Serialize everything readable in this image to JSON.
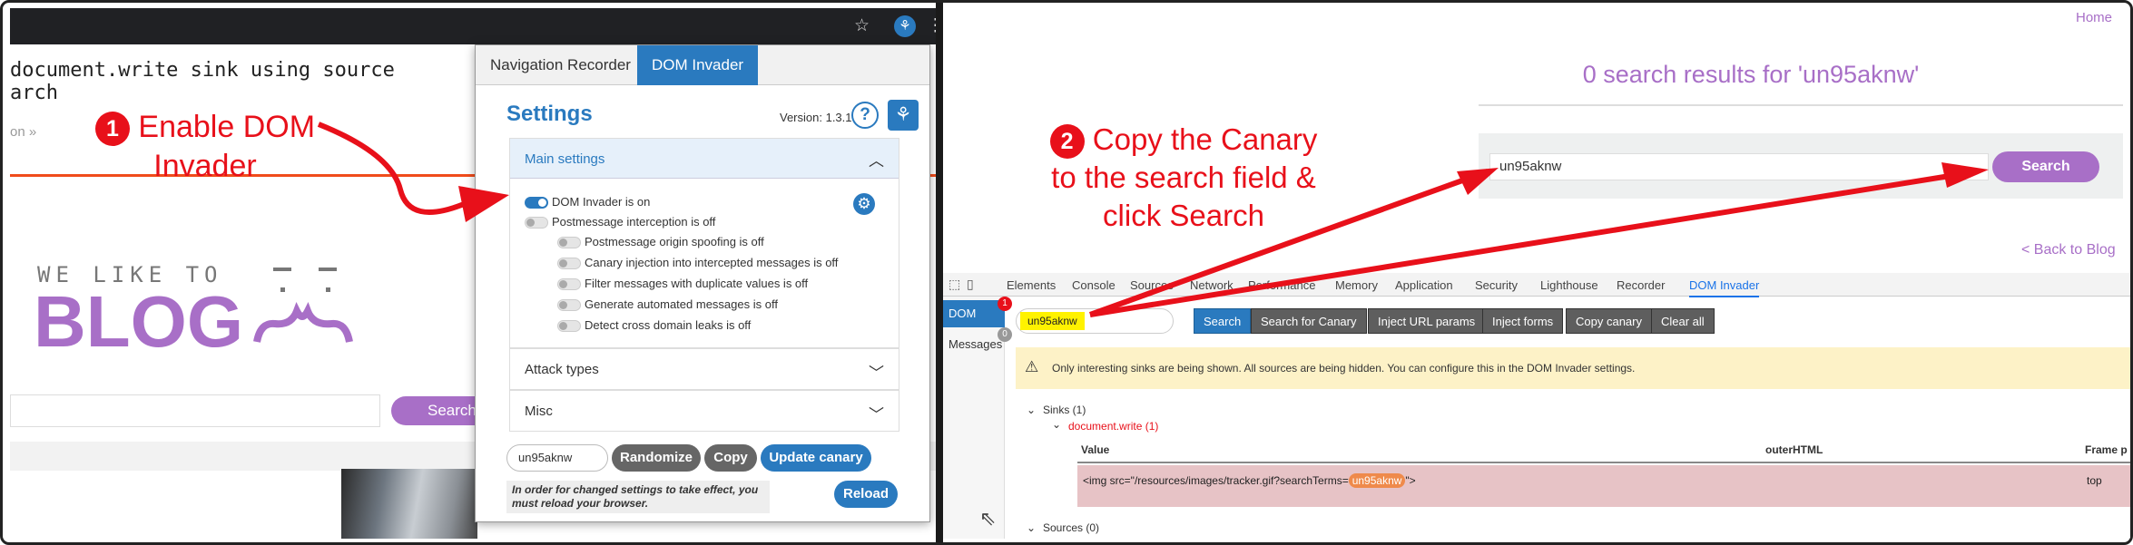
{
  "left": {
    "page_title_line1": "document.write sink using source",
    "page_title_line2": "arch",
    "breadcrumb": "on »",
    "blog_tag": "WE LIKE TO",
    "blog_name": "BLOG",
    "search_button": "Search"
  },
  "popup": {
    "tabs": [
      "Navigation Recorder",
      "DOM Invader"
    ],
    "settings_title": "Settings",
    "version": "Version: 1.3.1",
    "help_icon": "question-circle-icon",
    "main_settings_label": "Main settings",
    "options": [
      {
        "label": "DOM Invader is on",
        "on": true
      },
      {
        "label": "Postmessage interception is off",
        "on": false
      },
      {
        "label": "Postmessage origin spoofing is off",
        "on": false
      },
      {
        "label": "Canary injection into intercepted messages is off",
        "on": false
      },
      {
        "label": "Filter messages with duplicate values is off",
        "on": false
      },
      {
        "label": "Generate automated messages is off",
        "on": false
      },
      {
        "label": "Detect cross domain leaks is off",
        "on": false
      }
    ],
    "attack_types_label": "Attack types",
    "misc_label": "Misc",
    "canary_value": "un95aknw",
    "randomize_label": "Randomize",
    "copy_label": "Copy",
    "update_canary_label": "Update canary",
    "reload_notice": "In order for changed settings to take effect, you must reload your browser.",
    "reload_label": "Reload"
  },
  "right": {
    "home_link": "Home",
    "results_text": "0 search results for 'un95aknw'",
    "search_value": "un95aknw",
    "search_button": "Search",
    "back_link": "< Back to Blog",
    "devtools_tabs": [
      "Elements",
      "Console",
      "Sources",
      "Network",
      "Performance",
      "Memory",
      "Application",
      "Security",
      "Lighthouse",
      "Recorder",
      "DOM Invader"
    ],
    "side_dom": "DOM",
    "side_dom_badge": "1",
    "side_messages": "Messages",
    "side_messages_badge": "0",
    "canary_chip": "un95aknw",
    "dt_buttons": [
      "Search",
      "Search for Canary",
      "Inject URL params",
      "Inject forms",
      "Copy canary",
      "Clear all"
    ],
    "warning": "Only interesting sinks are being shown. All sources are being hidden. You can configure this in the DOM Invader settings.",
    "sinks_label": "Sinks (1)",
    "sink_name": "document.write (1)",
    "col_value": "Value",
    "col_outer": "outerHTML",
    "col_frame": "Frame p",
    "sink_value_prefix": "<img src=\"/resources/images/tracker.gif?searchTerms=",
    "sink_value_canary": "un95aknw",
    "sink_value_suffix": "\">",
    "sink_frame": "top",
    "sources_label": "Sources (0)"
  },
  "annotations": {
    "step1_number": "1",
    "step1_text": "Enable DOM Invader",
    "step2_number": "2",
    "step2_text": "Copy the Canary to the search field & click Search"
  },
  "colors": {
    "accent_blue": "#2a7abf",
    "blog_purple": "#a86fc7",
    "annotation_red": "#e8101a",
    "canary_yellow": "#fff200",
    "sink_row_pink": "#e7c3c6"
  }
}
